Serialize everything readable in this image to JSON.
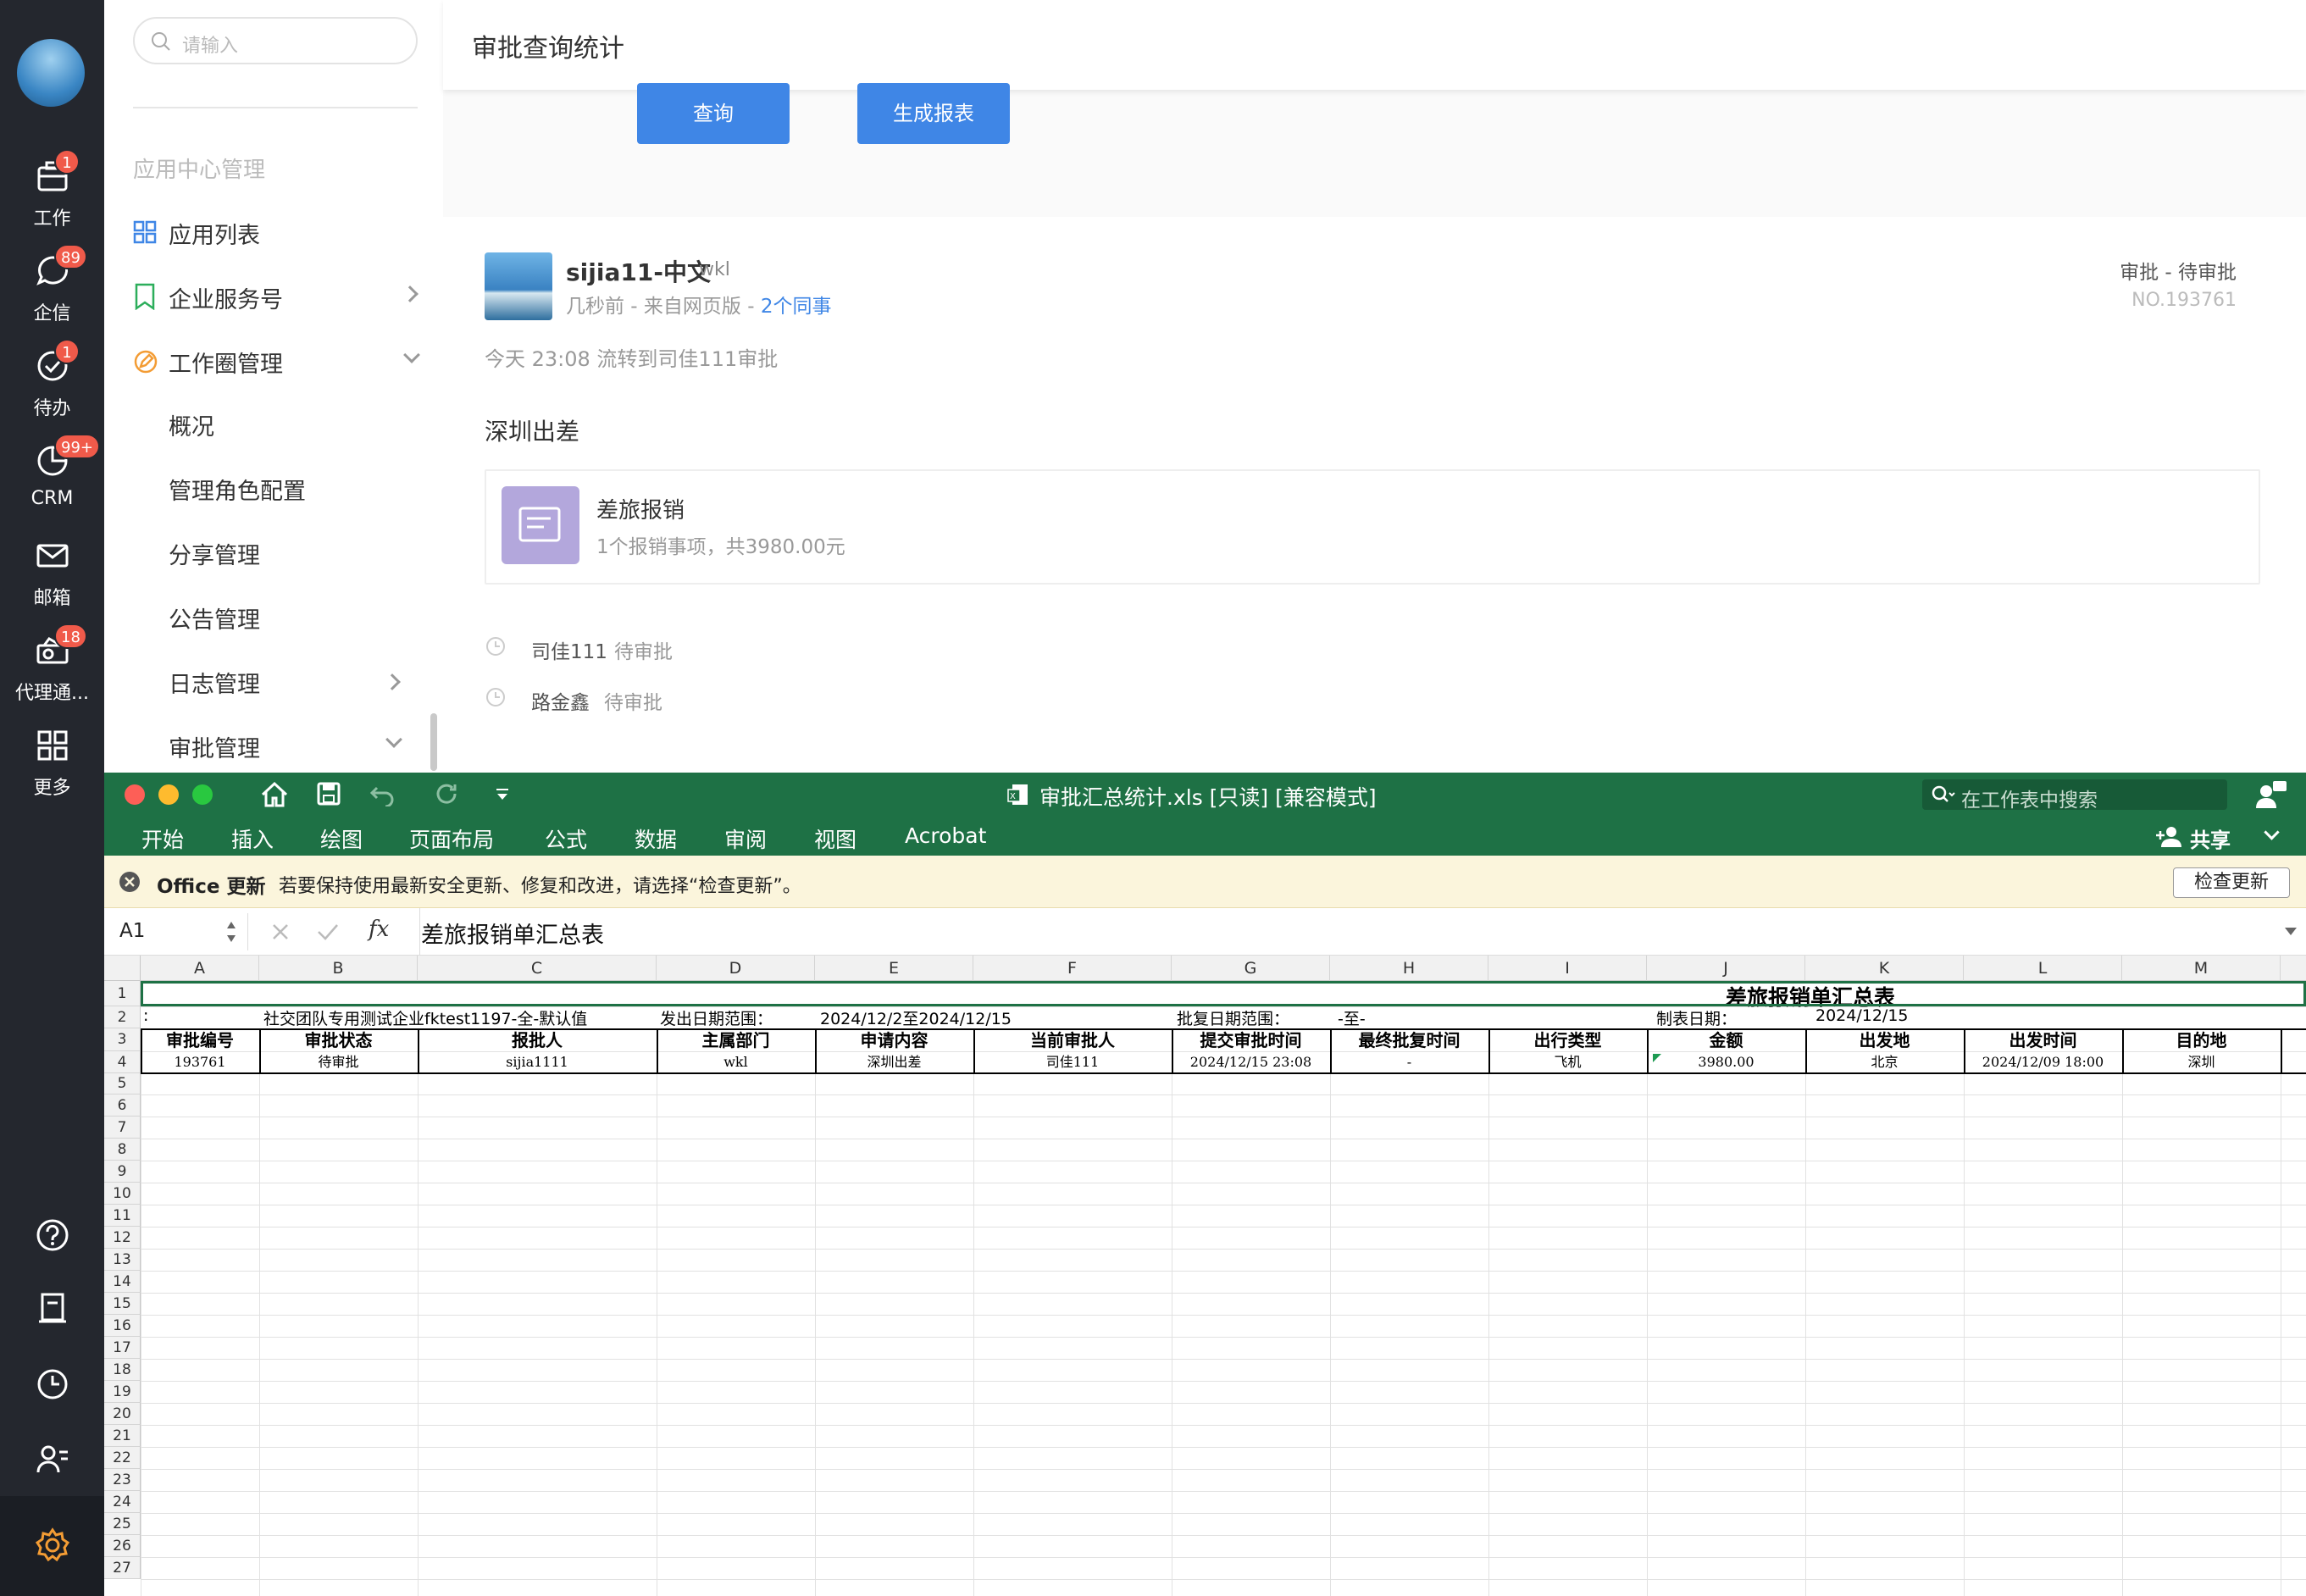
{
  "leftbar": {
    "items": [
      {
        "label": "工作",
        "icon": "briefcase-icon",
        "badge": "1"
      },
      {
        "label": "企信",
        "icon": "chat-icon",
        "badge": "89"
      },
      {
        "label": "待办",
        "icon": "check-circle-icon",
        "badge": "1"
      },
      {
        "label": "CRM",
        "icon": "pie-chart-icon",
        "badge": "99+"
      },
      {
        "label": "邮箱",
        "icon": "mail-icon",
        "badge": ""
      },
      {
        "label": "代理通...",
        "icon": "agent-icon",
        "badge": "18"
      },
      {
        "label": "更多",
        "icon": "grid-icon",
        "badge": ""
      }
    ]
  },
  "sidebar": {
    "search_placeholder": "请输入",
    "section_title": "应用中心管理",
    "items": [
      "应用列表",
      "企业服务号",
      "工作圈管理"
    ],
    "subitems": [
      "概况",
      "管理角色配置",
      "分享管理",
      "公告管理",
      "日志管理",
      "审批管理"
    ]
  },
  "main": {
    "page_title": "审批查询统计",
    "query_button": "查询",
    "report_button": "生成报表",
    "post": {
      "author": "sijia11-中文",
      "dept": "wkl",
      "meta": "几秒前 - 来自网页版 - ",
      "colleagues": "2个同事",
      "type": "审批 - 待审批",
      "no": "NO.193761",
      "flow": "今天 23:08 流转到司佳111审批",
      "title": "深圳出差",
      "attach_title": "差旅报销",
      "attach_sub": "1个报销事项，共3980.00元",
      "approvers": [
        {
          "name": "司佳111",
          "status": "待审批"
        },
        {
          "name": "路金鑫",
          "status": "待审批"
        }
      ]
    }
  },
  "excel": {
    "window_title": "审批汇总统计.xls  [只读]  [兼容模式]",
    "search_placeholder": "在工作表中搜索",
    "tabs": [
      "开始",
      "插入",
      "绘图",
      "页面布局",
      "公式",
      "数据",
      "审阅",
      "视图",
      "Acrobat"
    ],
    "share_label": "共享",
    "msg_bold": "Office 更新",
    "msg_text": "若要保持使用最新安全更新、修复和改进，请选择“检查更新”。",
    "msg_button": "检查更新",
    "name_box": "A1",
    "formula": "差旅报销单汇总表",
    "columns": [
      "A",
      "B",
      "C",
      "D",
      "E",
      "F",
      "G",
      "H",
      "I",
      "J",
      "K",
      "L",
      "M"
    ],
    "sheet_title": "差旅报销单汇总表",
    "row2": {
      "a": ":",
      "b": "社交团队专用测试企业fktest1197-全-默认值",
      "d": "发出日期范围：",
      "e": "2024/12/2至2024/12/15",
      "g": "批复日期范围：",
      "h": "-至-",
      "j": "制表日期：",
      "k": "2024/12/15"
    },
    "headers": [
      "审批编号",
      "审批状态",
      "报批人",
      "主属部门",
      "申请内容",
      "当前审批人",
      "提交审批时间",
      "最终批复时间",
      "出行类型",
      "金额",
      "出发地",
      "出发时间",
      "目的地"
    ],
    "row4": [
      "193761",
      "待审批",
      "sijia1111",
      "wkl",
      "深圳出差",
      "司佳111",
      "2024/12/15 23:08",
      "-",
      "飞机",
      "3980.00",
      "北京",
      "2024/12/09 18:00",
      "深圳"
    ],
    "rows": [
      "1",
      "2",
      "3",
      "4",
      "5",
      "6",
      "7",
      "8",
      "9",
      "10",
      "11",
      "12",
      "13",
      "14",
      "15",
      "16",
      "17",
      "18",
      "19",
      "20",
      "21",
      "22",
      "23",
      "24",
      "25",
      "26",
      "27"
    ]
  }
}
